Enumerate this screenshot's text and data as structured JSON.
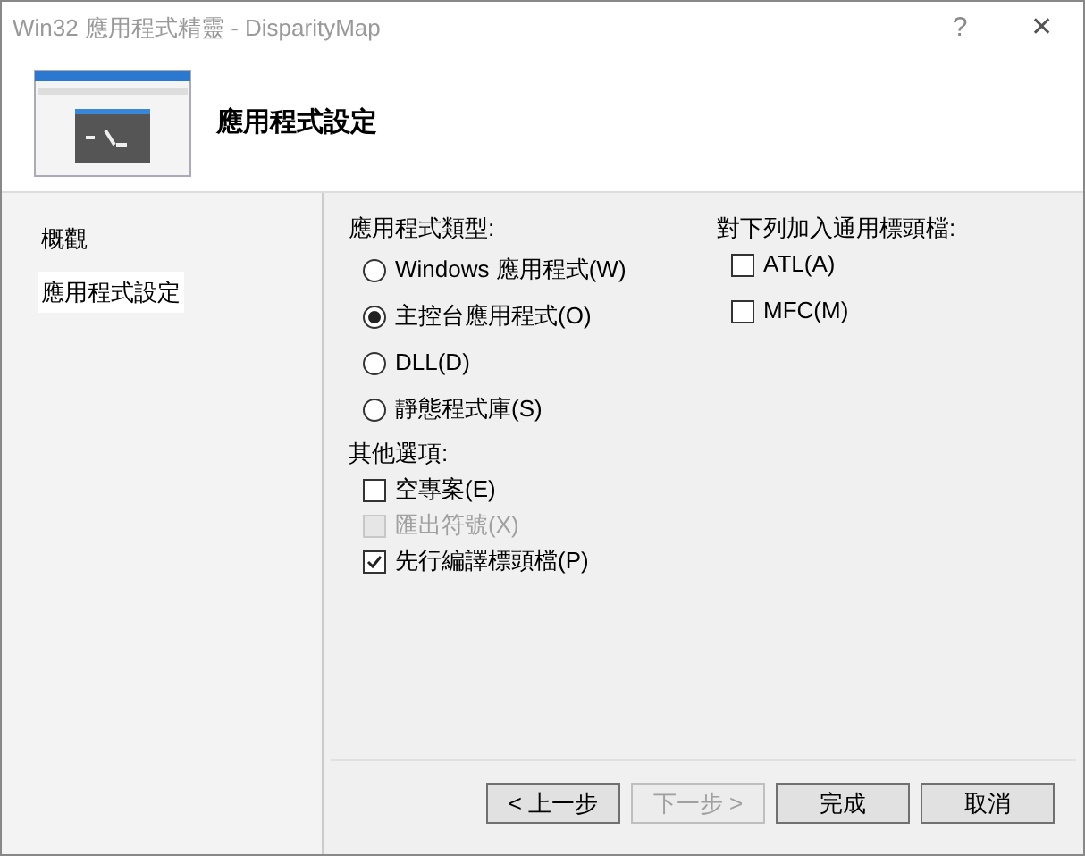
{
  "window": {
    "title": "Win32 應用程式精靈 - DisparityMap",
    "help": "?",
    "close": "✕"
  },
  "header": {
    "title": "應用程式設定"
  },
  "sidebar": {
    "items": [
      {
        "label": "概觀",
        "selected": false
      },
      {
        "label": "應用程式設定",
        "selected": true
      }
    ]
  },
  "app_type": {
    "label": "應用程式類型:",
    "options": [
      {
        "label": "Windows 應用程式(W)",
        "selected": false
      },
      {
        "label": "主控台應用程式(O)",
        "selected": true
      },
      {
        "label": "DLL(D)",
        "selected": false
      },
      {
        "label": "靜態程式庫(S)",
        "selected": false
      }
    ]
  },
  "other_options": {
    "label": "其他選項:",
    "options": [
      {
        "label": "空專案(E)",
        "checked": false,
        "disabled": false
      },
      {
        "label": "匯出符號(X)",
        "checked": false,
        "disabled": true
      },
      {
        "label": "先行編譯標頭檔(P)",
        "checked": true,
        "disabled": false
      }
    ]
  },
  "headers": {
    "label": "對下列加入通用標頭檔:",
    "options": [
      {
        "label": "ATL(A)",
        "checked": false
      },
      {
        "label": "MFC(M)",
        "checked": false
      }
    ]
  },
  "buttons": [
    {
      "label": "< 上一步",
      "disabled": false
    },
    {
      "label": "下一步 >",
      "disabled": true
    },
    {
      "label": "完成",
      "disabled": false
    },
    {
      "label": "取消",
      "disabled": false
    }
  ]
}
